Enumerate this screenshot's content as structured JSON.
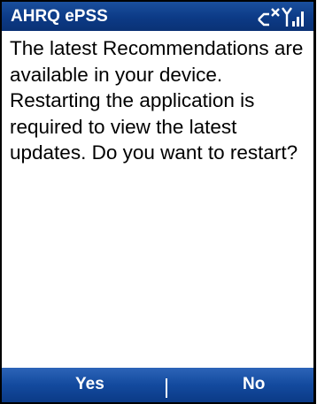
{
  "titlebar": {
    "app_title": "AHRQ ePSS",
    "icons": [
      "connectivity-off-icon",
      "signal-strength-icon"
    ]
  },
  "dialog": {
    "message": "The latest Recommendations are available in your device. Restarting the application is required to view the latest updates. Do you want to restart?"
  },
  "softkeys": {
    "left_label": "Yes",
    "right_label": "No"
  },
  "colors": {
    "title_bar": "#0c3a86",
    "softkey_bar": "#134a9e",
    "text": "#000000",
    "background": "#ffffff"
  }
}
